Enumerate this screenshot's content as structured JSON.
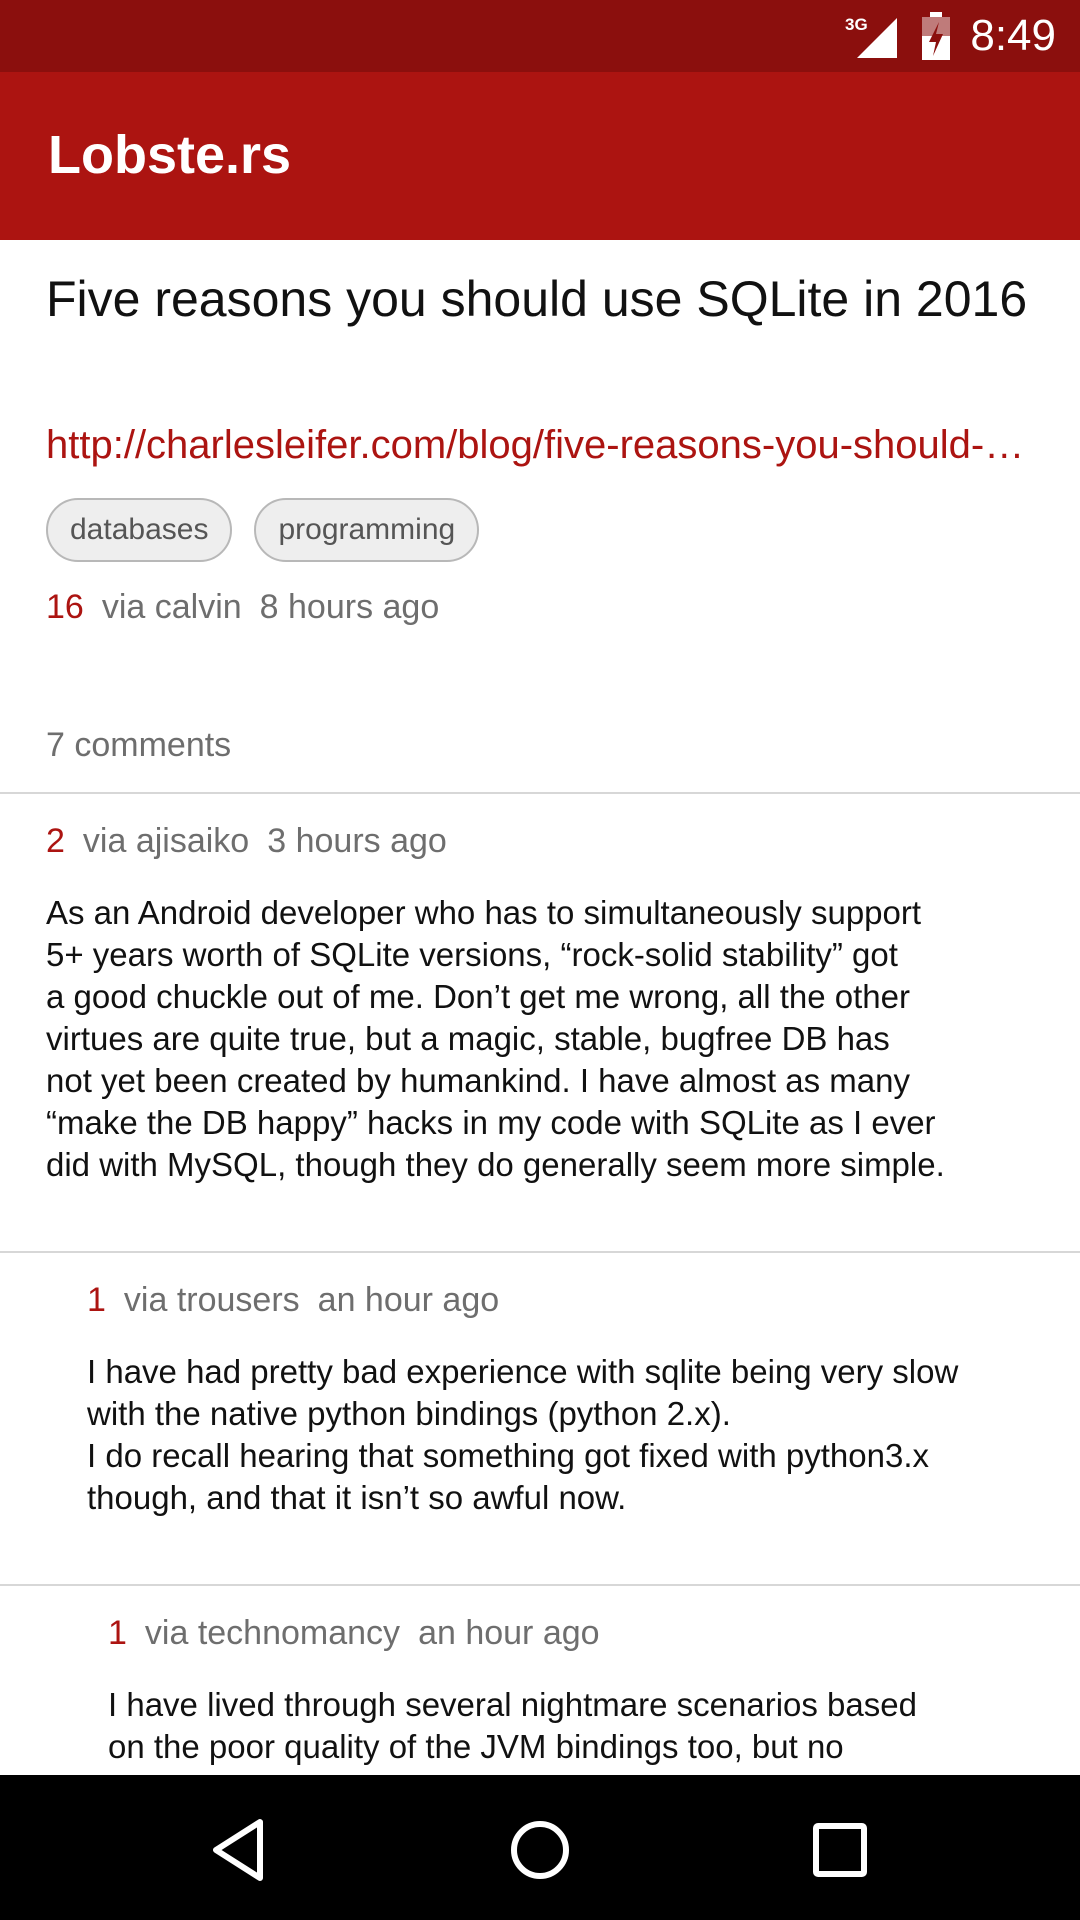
{
  "status_bar": {
    "network": "3G",
    "time": "8:49",
    "icons": [
      "signal-icon",
      "battery-icon"
    ]
  },
  "app_bar": {
    "title": "Lobste.rs"
  },
  "story": {
    "title": "Five reasons you should use SQLite in 2016",
    "url": "http://charlesleifer.com/blog/five-reasons-you-should-use-sqlite-in-2016/",
    "tags": [
      "databases",
      "programming"
    ],
    "score": "16",
    "via": "via calvin",
    "time": "8 hours ago",
    "comments_label": "7 comments"
  },
  "comments": [
    {
      "score": "2",
      "via": "via ajisaiko",
      "time": "3 hours ago",
      "lines": [
        "As an Android developer who has to simultaneously support",
        "5+ years worth of SQLite versions, “rock-solid stability” got",
        "a good chuckle out of me. Don’t get me wrong, all the other",
        "virtues are quite true, but a magic, stable, bugfree DB has",
        "not yet been created by humankind. I have almost as many",
        "“make the DB happy” hacks in my code with SQLite as I ever",
        "did with MySQL, though they do generally seem more simple."
      ]
    },
    {
      "score": "1",
      "via": "via trousers",
      "time": "an hour ago",
      "lines": [
        "I have had pretty bad experience with sqlite being very slow",
        "with the native python bindings (python 2.x).",
        "I do recall hearing that something got fixed with python3.x",
        "though, and that it isn’t so awful now."
      ]
    },
    {
      "score": "1",
      "via": "via technomancy",
      "time": "an hour ago",
      "lines": [
        "I have lived through several nightmare scenarios based",
        "on the poor quality of the JVM bindings too, but no"
      ]
    }
  ],
  "nav_bar": {
    "buttons": [
      "back-icon",
      "home-icon",
      "recents-icon"
    ]
  }
}
